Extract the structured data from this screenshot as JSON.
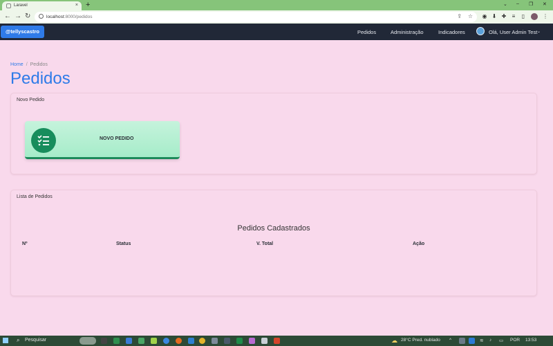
{
  "browser": {
    "tab_title": "Laravel",
    "tab_close": "×",
    "new_tab": "+",
    "url_host": "localhost",
    "url_rest": ":8000/pedidos"
  },
  "navbar": {
    "brand": "@tellyscastro",
    "links": [
      "Pedidos",
      "Administração",
      "Indicadores"
    ],
    "user": "Olá, User Admin Test"
  },
  "breadcrumb": {
    "home": "Home",
    "current": "Pedidos"
  },
  "page_title": "Pedidos",
  "new_order_card": {
    "header": "Novo Pedido",
    "tile_label": "NOVO PEDIDO"
  },
  "orders_card": {
    "header": "Lista de Pedidos",
    "table_title": "Pedidos Cadastrados",
    "columns": [
      "Nº",
      "Status",
      "V. Total",
      "Ação"
    ]
  },
  "taskbar": {
    "search": "Pesquisar",
    "weather": "28°C  Pred. nublado",
    "lang": "POR",
    "time": "13:53"
  },
  "colors": {
    "brand_blue": "#2f7be8",
    "navbar_bg": "#212837",
    "page_bg": "#f9d9ec",
    "tile_green": "#178d5c",
    "browser_green": "#86c47a"
  }
}
